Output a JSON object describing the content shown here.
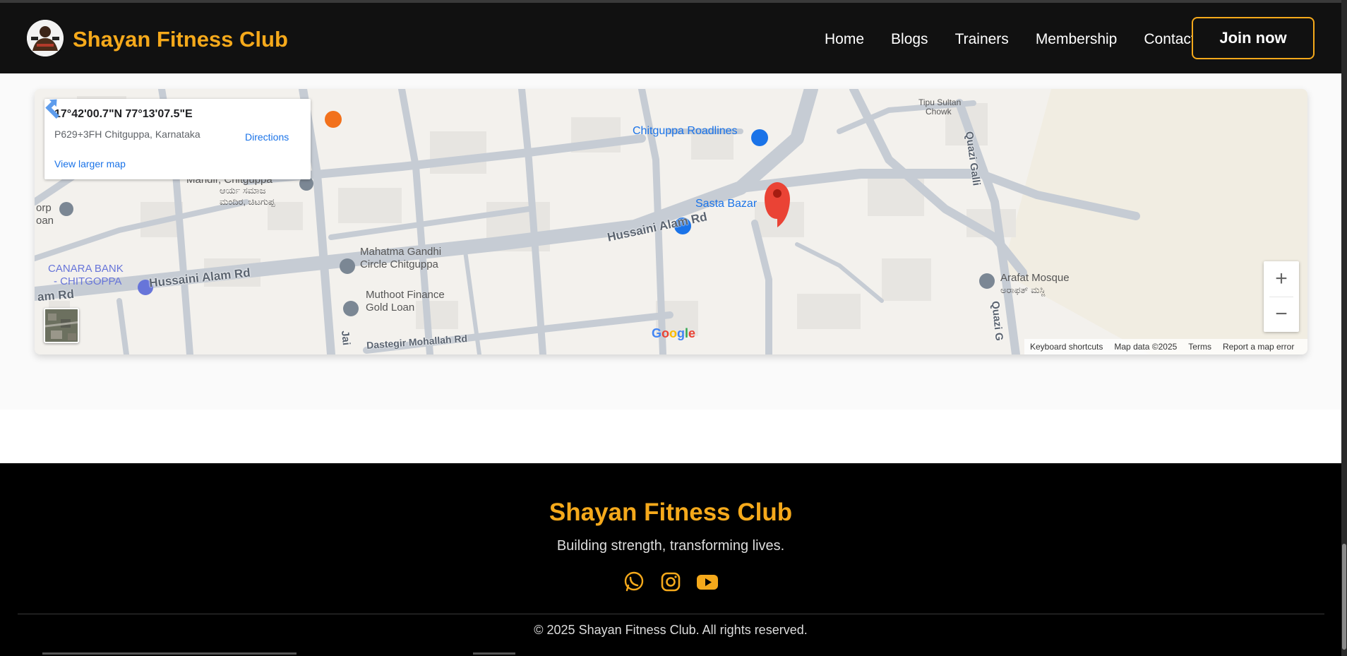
{
  "header": {
    "brand": "Shayan Fitness Club",
    "nav": [
      "Home",
      "Blogs",
      "Trainers",
      "Membership",
      "Contact"
    ],
    "join_label": "Join now"
  },
  "map": {
    "coords": "17°42'00.7\"N 77°13'07.5\"E",
    "plus_code": "P629+3FH Chitguppa, Karnataka",
    "directions_label": "Directions",
    "view_larger": "View larger map",
    "zoom_in": "+",
    "zoom_out": "−",
    "footer_links": [
      "Keyboard shortcuts",
      "Map data ©2025",
      "Terms",
      "Report a map error"
    ],
    "google_logo": "Google",
    "labels": {
      "chitguppa_roadlines": "Chitguppa Roadlines",
      "sasta_bazar": "Sasta Bazar",
      "hussaini_alam_rd_1": "Hussaini Alam Rd",
      "hussaini_alam_rd_2": "Hussaini Alam Rd",
      "am_rd": "am Rd",
      "mahatma_gandhi_1": "Mahatma Gandhi",
      "mahatma_gandhi_2": "Circle Chitguppa",
      "canara_1": "CANARA BANK",
      "canara_2": "- CHITGOPPA",
      "muthoot_1": "Muthoot Finance",
      "muthoot_2": "Gold Loan",
      "dastegir": "Dastegir Mohallah Rd",
      "arafat": "Arafat Mosque",
      "arafat_kn": "ಅರಾಫತ್ ಮಸ್ಜಿ",
      "tipu_1": "Tipu Sultan",
      "tipu_2": "Chowk",
      "quazi_galli": "Quazi Galli",
      "quazi_g": "Quazi G",
      "mandir": "Mandir, Chitguppa",
      "mandir_kn": "ಆರ್ಯ ಸಮಾಜ",
      "mandir_kn2": "ಮಂದಿರ, ಚಿಟಗುಪ್ಪ",
      "corp": "orp",
      "oan": "oan",
      "jai": "Jai"
    }
  },
  "footer": {
    "title": "Shayan Fitness Club",
    "tagline": "Building strength, transforming lives.",
    "social": [
      "whatsapp-icon",
      "instagram-icon",
      "youtube-icon"
    ],
    "copyright": "© 2025 Shayan Fitness Club. All rights reserved."
  },
  "colors": {
    "accent": "#f5a91b",
    "header_bg": "#111111",
    "footer_bg": "#000000",
    "link_blue": "#1a73e8",
    "pin_red": "#ea4335"
  }
}
